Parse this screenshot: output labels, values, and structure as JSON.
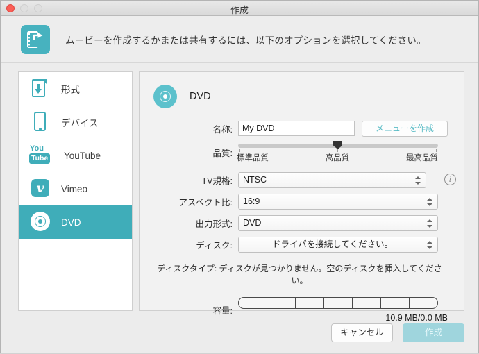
{
  "window": {
    "title": "作成",
    "traffic_lights": [
      "close",
      "minimize",
      "maximize"
    ],
    "accent_color": "#3fadb9",
    "create_button_color": "#9fd5dd"
  },
  "header": {
    "icon": "share-movie-icon",
    "message": "ムービーを作成するかまたは共有するには、以下のオプションを選択してください。"
  },
  "sidebar": {
    "items": [
      {
        "label": "形式",
        "icon": "document-download-icon",
        "selected": false
      },
      {
        "label": "デバイス",
        "icon": "phone-icon",
        "selected": false
      },
      {
        "label": "YouTube",
        "icon": "youtube-icon",
        "selected": false
      },
      {
        "label": "Vimeo",
        "icon": "vimeo-icon",
        "selected": false
      },
      {
        "label": "DVD",
        "icon": "dvd-disc-icon",
        "selected": true
      }
    ],
    "youtube_icon_text": {
      "top": "You",
      "bottom": "Tube"
    },
    "vimeo_icon_text": "v"
  },
  "panel": {
    "title": "DVD",
    "icon": "dvd-disc-icon",
    "fields": {
      "name": {
        "label": "名称:",
        "value": "My DVD",
        "placeholder": "My DVD",
        "button_label": "メニューを作成"
      },
      "quality": {
        "label": "品質:",
        "scale_min": "標準品質",
        "scale_mid": "高品質",
        "scale_max": "最高品質",
        "selected": "高品質"
      },
      "tv_standard": {
        "label": "TV規格:",
        "value": "NTSC",
        "info_icon": "info-icon"
      },
      "aspect_ratio": {
        "label": "アスペクト比:",
        "value": "16:9"
      },
      "output_format": {
        "label": "出力形式:",
        "value": "DVD"
      },
      "disc": {
        "label": "ディスク:",
        "value": "ドライバを接続してください。"
      }
    },
    "disc_type": {
      "label": "ディスクタイプ:",
      "message": "ディスクが見つかりません。空のディスクを挿入してください。"
    },
    "capacity": {
      "label": "容量:",
      "segments": 7,
      "size_text": "10.9 MB/0.0 MB"
    }
  },
  "footer": {
    "cancel_label": "キャンセル",
    "create_label": "作成"
  }
}
